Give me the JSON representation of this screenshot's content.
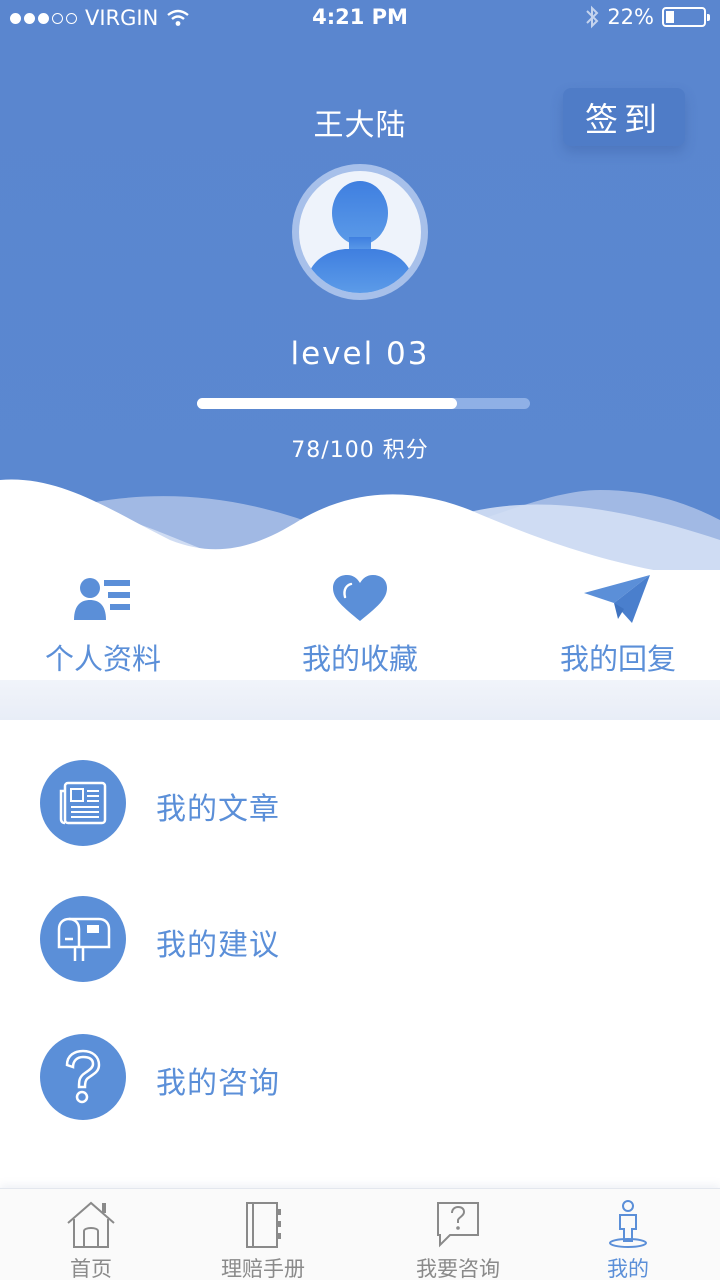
{
  "status_bar": {
    "carrier": "VIRGIN",
    "time": "4:21 PM",
    "battery": "22%",
    "signal_filled": 3,
    "signal_total": 5,
    "battery_level": 0.22
  },
  "profile": {
    "name": "王大陆",
    "checkin_label": "签到",
    "level": "level 03",
    "points_text": "78/100 积分",
    "points_current": 78,
    "points_max": 100
  },
  "shortcuts": [
    {
      "label": "个人资料",
      "icon": "profile-card-icon"
    },
    {
      "label": "我的收藏",
      "icon": "heart-icon"
    },
    {
      "label": "我的回复",
      "icon": "paper-plane-icon"
    }
  ],
  "menu": [
    {
      "label": "我的文章",
      "icon": "newspaper-icon"
    },
    {
      "label": "我的建议",
      "icon": "mailbox-icon"
    },
    {
      "label": "我的咨询",
      "icon": "question-icon"
    }
  ],
  "tabs": [
    {
      "label": "首页",
      "icon": "home-icon",
      "active": false
    },
    {
      "label": "理赔手册",
      "icon": "notebook-icon",
      "active": false
    },
    {
      "label": "我要咨询",
      "icon": "question-bubble-icon",
      "active": false
    },
    {
      "label": "我的",
      "icon": "person-icon",
      "active": true
    }
  ],
  "colors": {
    "header_blue": "#5b88d0",
    "accent": "#5b8fd8",
    "tab_inactive": "#8a8a8a"
  }
}
